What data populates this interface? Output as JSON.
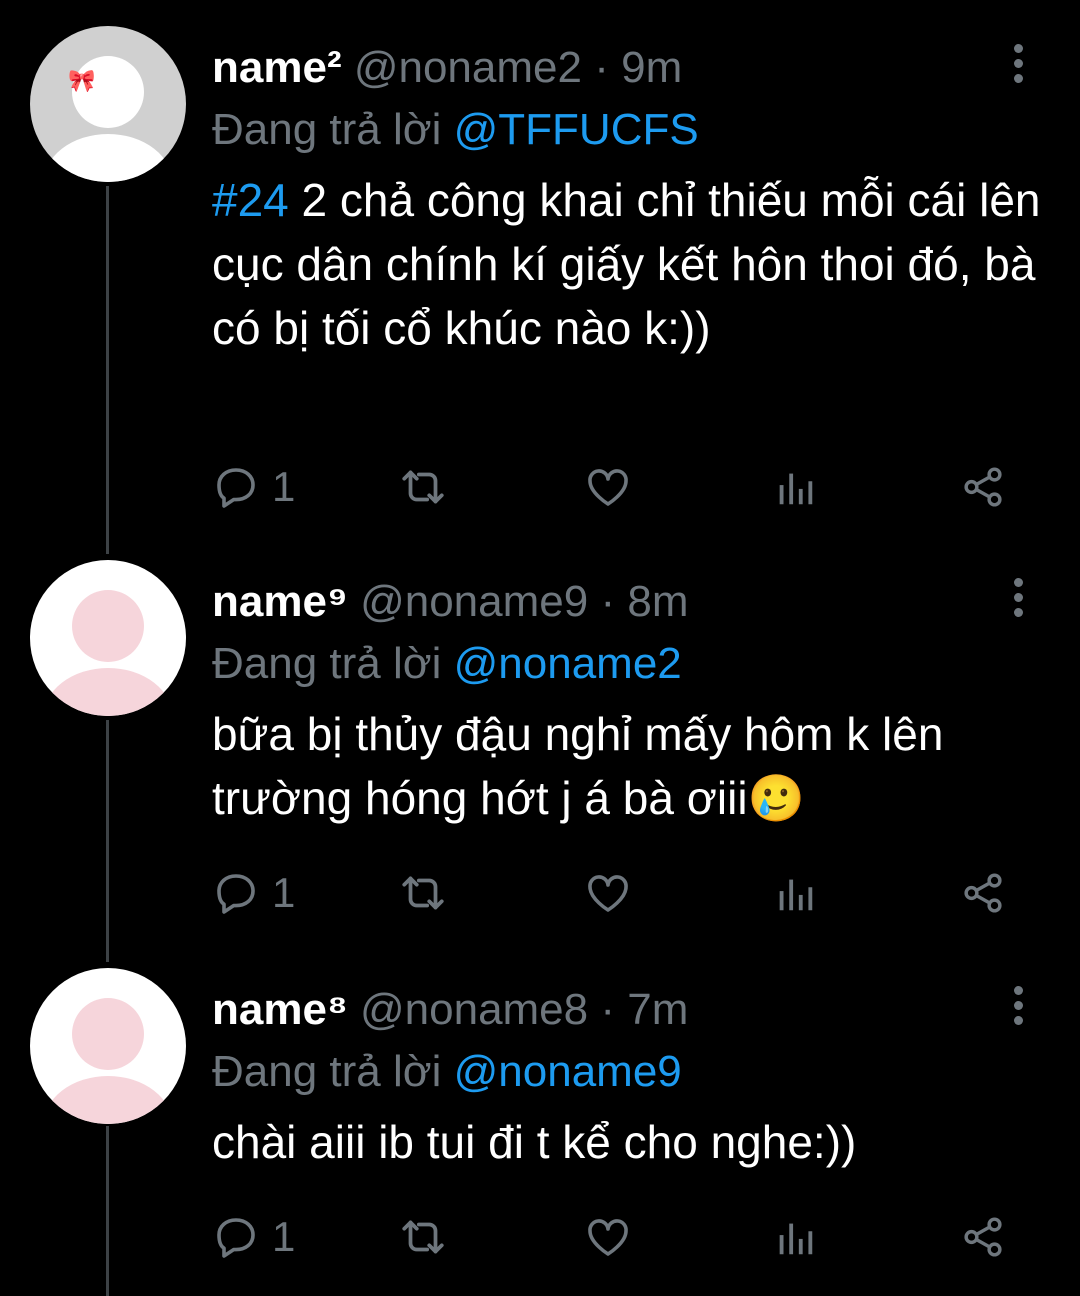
{
  "tweets": [
    {
      "name": "name²",
      "handle": "@noname2",
      "time": "9m",
      "replying_label": "Đang trả lời",
      "replying_to": "@TFFUCFS",
      "hashtag": "#24",
      "text": "2 chả công khai chỉ thiếu mỗi cái lên cục dân chính kí giấy kết hôn thoi đó, bà có bị tối cổ khúc nào k:))",
      "reply_count": "1"
    },
    {
      "name": "name⁹",
      "handle": "@noname9",
      "time": "8m",
      "replying_label": "Đang trả lời",
      "replying_to": "@noname2",
      "hashtag": "",
      "text": "bữa bị thủy đậu nghỉ mấy hôm k lên trường hóng hớt j á bà ơiii🥲",
      "reply_count": "1"
    },
    {
      "name": "name⁸",
      "handle": "@noname8",
      "time": "7m",
      "replying_label": "Đang trả lời",
      "replying_to": "@noname9",
      "hashtag": "",
      "text": "chài aiii ib tui đi t kể cho nghe:))",
      "reply_count": "1"
    }
  ],
  "separator": "·",
  "colors": {
    "background": "#000000",
    "link": "#1d9bf0",
    "muted": "#6e767d",
    "text": "#ffffff"
  },
  "icons": [
    "reply-icon",
    "retweet-icon",
    "like-icon",
    "analytics-icon",
    "share-icon",
    "more-icon"
  ]
}
